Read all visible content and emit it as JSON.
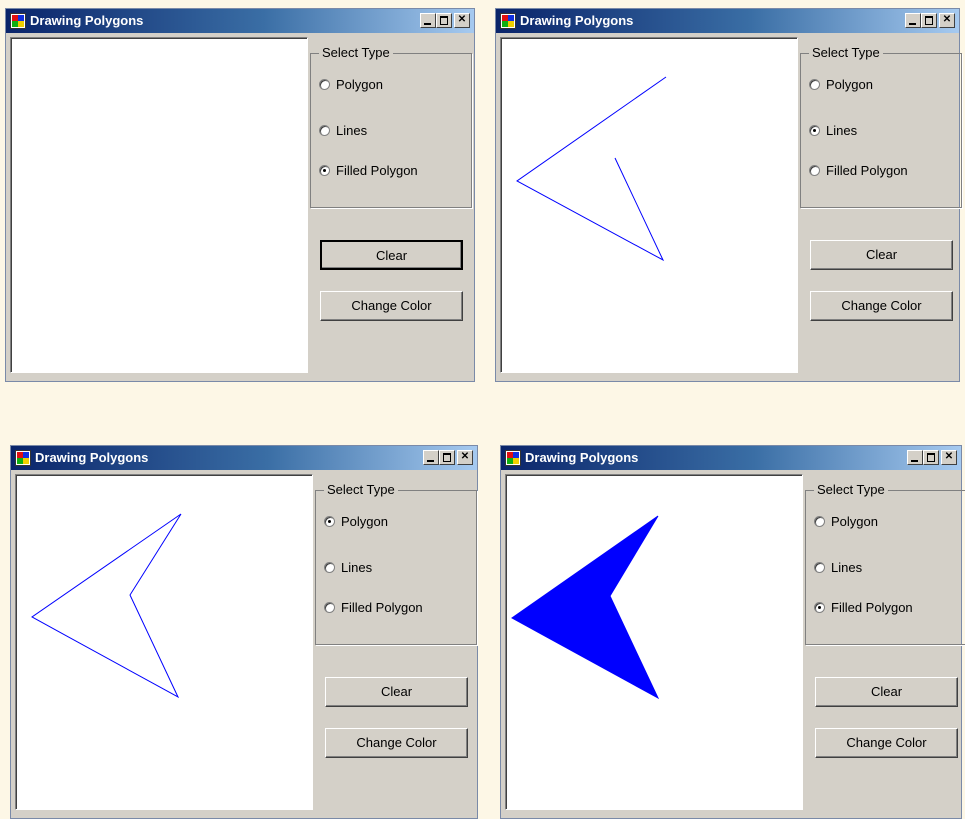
{
  "windows": [
    {
      "title": "Drawing Polygons",
      "group_title": "Select Type",
      "radios": [
        {
          "label": "Polygon",
          "checked": false
        },
        {
          "label": "Lines",
          "checked": false
        },
        {
          "label": "Filled Polygon",
          "checked": true
        }
      ],
      "clear_label": "Clear",
      "change_color_label": "Change Color",
      "drawing": {
        "mode": "none",
        "color": "#0000ff"
      }
    },
    {
      "title": "Drawing Polygons",
      "group_title": "Select Type",
      "radios": [
        {
          "label": "Polygon",
          "checked": false
        },
        {
          "label": "Lines",
          "checked": true
        },
        {
          "label": "Filled Polygon",
          "checked": false
        }
      ],
      "clear_label": "Clear",
      "change_color_label": "Change Color",
      "drawing": {
        "mode": "lines",
        "color": "#0000ff"
      }
    },
    {
      "title": "Drawing Polygons",
      "group_title": "Select Type",
      "radios": [
        {
          "label": "Polygon",
          "checked": true
        },
        {
          "label": "Lines",
          "checked": false
        },
        {
          "label": "Filled Polygon",
          "checked": false
        }
      ],
      "clear_label": "Clear",
      "change_color_label": "Change Color",
      "drawing": {
        "mode": "polygon",
        "color": "#0000ff"
      }
    },
    {
      "title": "Drawing Polygons",
      "group_title": "Select Type",
      "radios": [
        {
          "label": "Polygon",
          "checked": false
        },
        {
          "label": "Lines",
          "checked": false
        },
        {
          "label": "Filled Polygon",
          "checked": true
        }
      ],
      "clear_label": "Clear",
      "change_color_label": "Change Color",
      "drawing": {
        "mode": "filled",
        "color": "#0000ff"
      }
    }
  ]
}
